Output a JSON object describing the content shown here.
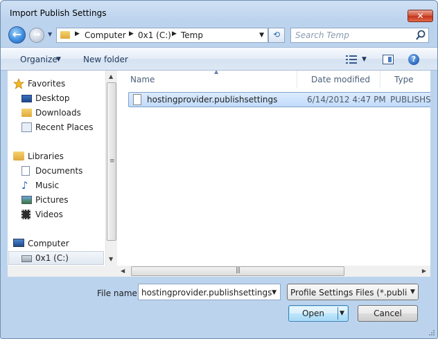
{
  "window": {
    "title": "Import Publish Settings",
    "close_glyph": "✕"
  },
  "address_bar": {
    "path": [
      "Computer",
      "0x1 (C:)",
      "Temp"
    ],
    "separator": "▶",
    "search_placeholder": "Search Temp"
  },
  "toolbar": {
    "organize_label": "Organize",
    "new_folder_label": "New folder"
  },
  "nav_pane": {
    "favorites": {
      "label": "Favorites",
      "items": [
        {
          "label": "Desktop",
          "icon": "desktop-icon"
        },
        {
          "label": "Downloads",
          "icon": "downloads-icon"
        },
        {
          "label": "Recent Places",
          "icon": "recent-places-icon"
        }
      ]
    },
    "libraries": {
      "label": "Libraries",
      "items": [
        {
          "label": "Documents",
          "icon": "documents-icon"
        },
        {
          "label": "Music",
          "icon": "music-icon"
        },
        {
          "label": "Pictures",
          "icon": "pictures-icon"
        },
        {
          "label": "Videos",
          "icon": "videos-icon"
        }
      ]
    },
    "computer": {
      "label": "Computer",
      "items": [
        {
          "label": "0x1 (C:)",
          "icon": "drive-icon",
          "selected": true
        }
      ]
    }
  },
  "file_list": {
    "columns": [
      {
        "key": "name",
        "label": "Name"
      },
      {
        "key": "date",
        "label": "Date modified"
      },
      {
        "key": "type",
        "label": "Type"
      }
    ],
    "rows": [
      {
        "name": "hostingprovider.publishsettings",
        "date": "6/14/2012 4:47 PM",
        "type": "PUBLISHS",
        "selected": true
      }
    ]
  },
  "footer": {
    "file_name_label": "File name:",
    "file_name_value": "hostingprovider.publishsettings",
    "file_type_value": "Profile Settings Files (*.publishs",
    "open_label": "Open",
    "cancel_label": "Cancel"
  },
  "colors": {
    "selection_border": "#7da2ce",
    "selection_fill": "#c1dbfc",
    "chrome": "#bcd3ee"
  }
}
